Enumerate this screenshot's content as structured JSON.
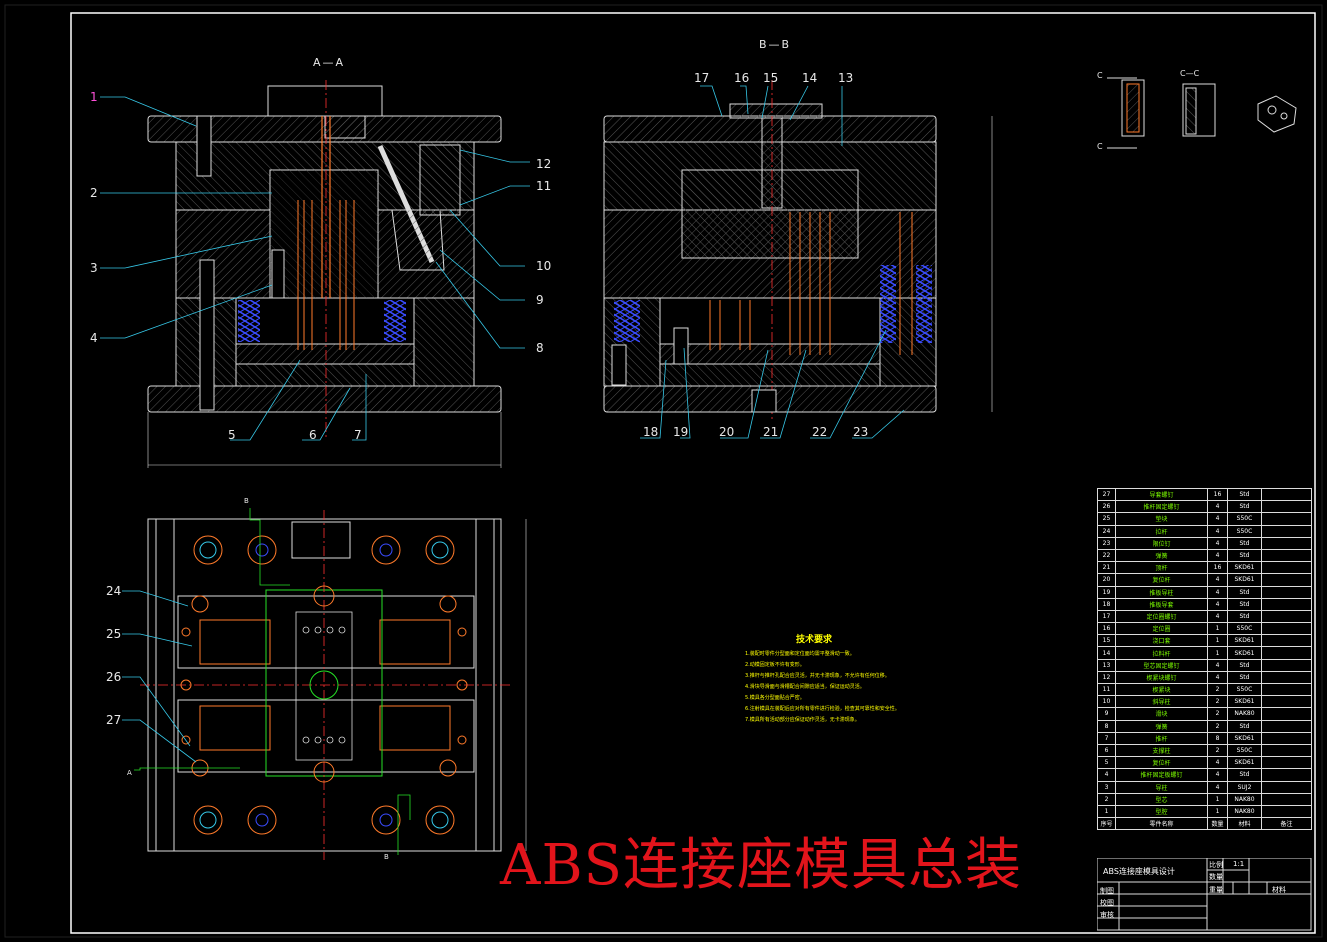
{
  "drawing": {
    "main_title": "ABS连接座模具总装",
    "view_labels": {
      "section_aa": "A—A",
      "section_bb": "B—B",
      "section_cc": "C—C",
      "section_c_left": "C"
    },
    "leaders_left": [
      "1",
      "2",
      "3",
      "4",
      "5",
      "6",
      "7",
      "8",
      "9",
      "10",
      "11",
      "12"
    ],
    "leaders_right": [
      "13",
      "14",
      "15",
      "16",
      "17",
      "18",
      "19",
      "20",
      "21",
      "22",
      "23"
    ],
    "leaders_plan": [
      "24",
      "25",
      "26",
      "27"
    ],
    "plan_markers": {
      "b_top": "B",
      "b_bottom": "B",
      "a_left": "A"
    },
    "tech_title": "技术要求",
    "tech_lines": [
      "1.装配时零件分型面和定位面均需平整滑动一致。",
      "2.动模固定板不许有变形。",
      "3.推杆与推杆孔配合应灵活，并无卡滞现象，不允许有任何位移。",
      "4.滑块导滑面与滑槽配合间隙应适当，保证运动灵活。",
      "5.模具各分型面贴合严密。",
      "6.注射模具在装配后应对所有零件进行检验，检查其可靠性和安全性。",
      "7.模具所有活动部分应保证动作灵活，无卡滞现象。"
    ]
  },
  "bom": [
    {
      "no": "27",
      "name": "导套螺钉",
      "qty": "16",
      "mat": "Std"
    },
    {
      "no": "26",
      "name": "推杆固定螺钉",
      "qty": "4",
      "mat": "Std"
    },
    {
      "no": "25",
      "name": "垫块",
      "qty": "4",
      "mat": "S50C"
    },
    {
      "no": "24",
      "name": "拉杆",
      "qty": "4",
      "mat": "S50C"
    },
    {
      "no": "23",
      "name": "限位钉",
      "qty": "4",
      "mat": "Std"
    },
    {
      "no": "22",
      "name": "弹簧",
      "qty": "4",
      "mat": "Std"
    },
    {
      "no": "21",
      "name": "顶杆",
      "qty": "16",
      "mat": "SKD61"
    },
    {
      "no": "20",
      "name": "复位杆",
      "qty": "4",
      "mat": "SKD61"
    },
    {
      "no": "19",
      "name": "推板导柱",
      "qty": "4",
      "mat": "Std"
    },
    {
      "no": "18",
      "name": "推板导套",
      "qty": "4",
      "mat": "Std"
    },
    {
      "no": "17",
      "name": "定位圈螺钉",
      "qty": "4",
      "mat": "Std"
    },
    {
      "no": "16",
      "name": "定位圈",
      "qty": "1",
      "mat": "S50C"
    },
    {
      "no": "15",
      "name": "浇口套",
      "qty": "1",
      "mat": "SKD61"
    },
    {
      "no": "14",
      "name": "拉料杆",
      "qty": "1",
      "mat": "SKD61"
    },
    {
      "no": "13",
      "name": "型芯固定螺钉",
      "qty": "4",
      "mat": "Std"
    },
    {
      "no": "12",
      "name": "楔紧块螺钉",
      "qty": "4",
      "mat": "Std"
    },
    {
      "no": "11",
      "name": "楔紧块",
      "qty": "2",
      "mat": "S50C"
    },
    {
      "no": "10",
      "name": "斜导柱",
      "qty": "2",
      "mat": "SKD61"
    },
    {
      "no": "9",
      "name": "滑块",
      "qty": "2",
      "mat": "NAK80"
    },
    {
      "no": "8",
      "name": "弹簧",
      "qty": "2",
      "mat": "Std"
    },
    {
      "no": "7",
      "name": "推杆",
      "qty": "8",
      "mat": "SKD61"
    },
    {
      "no": "6",
      "name": "支撑柱",
      "qty": "2",
      "mat": "S50C"
    },
    {
      "no": "5",
      "name": "复位杆",
      "qty": "4",
      "mat": "SKD61"
    },
    {
      "no": "4",
      "name": "推杆固定板螺钉",
      "qty": "4",
      "mat": "Std"
    },
    {
      "no": "3",
      "name": "导柱",
      "qty": "4",
      "mat": "SUJ2"
    },
    {
      "no": "2",
      "name": "型芯",
      "qty": "1",
      "mat": "NAK80"
    },
    {
      "no": "1",
      "name": "型腔",
      "qty": "1",
      "mat": "NAK80"
    }
  ],
  "bom_header": {
    "no": "序号",
    "name": "零件名称",
    "qty": "数量",
    "mat": "材料",
    "note": "备注"
  },
  "title_block": {
    "name": "ABS连接座模具设计",
    "scale_label": "比例",
    "scale_value": "1:1",
    "qty_label": "数量",
    "drawn": "制图",
    "checked": "校图",
    "approved": "审核",
    "weight": "重量",
    "material": "材料"
  },
  "colors": {
    "frame": "#ffffff",
    "title": "#e2141b",
    "tech": "#ffff00",
    "hatch": "#4d4d4d",
    "spring": "#3340ff",
    "pin": "#ff7a2a",
    "center": "#ff3030",
    "cyan": "#36c8e8",
    "green": "#26e026"
  }
}
